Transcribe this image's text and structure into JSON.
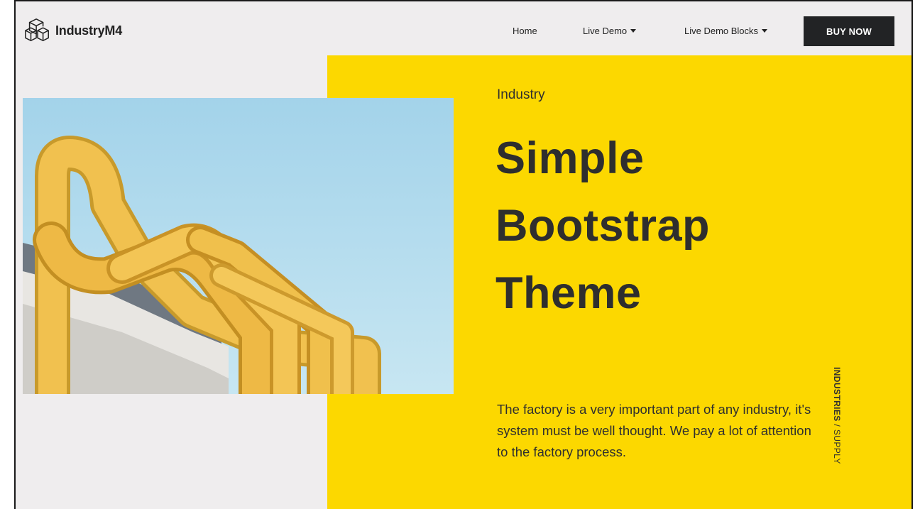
{
  "brand": {
    "name": "IndustryM4",
    "logo_icon": "cubes-logo-icon"
  },
  "nav": {
    "items": [
      {
        "label": "Home",
        "has_dropdown": false
      },
      {
        "label": "Live Demo",
        "has_dropdown": true
      },
      {
        "label": "Live Demo Blocks",
        "has_dropdown": true
      }
    ],
    "cta_label": "BUY NOW"
  },
  "hero": {
    "eyebrow": "Industry",
    "headline_lines": [
      "Simple",
      "Bootstrap",
      "Theme"
    ],
    "description": "The factory is a very important part of any industry, it's system must be well thought. We pay a lot of attention to the factory process.",
    "vertical_tag": {
      "strong": "INDUSTRIES",
      "separator": " / ",
      "light": "SUPPLY"
    }
  },
  "colors": {
    "accent_yellow": "#fcd800",
    "page_bg": "#efedee",
    "button_dark": "#222325",
    "text_dark": "#2e2e2e"
  }
}
